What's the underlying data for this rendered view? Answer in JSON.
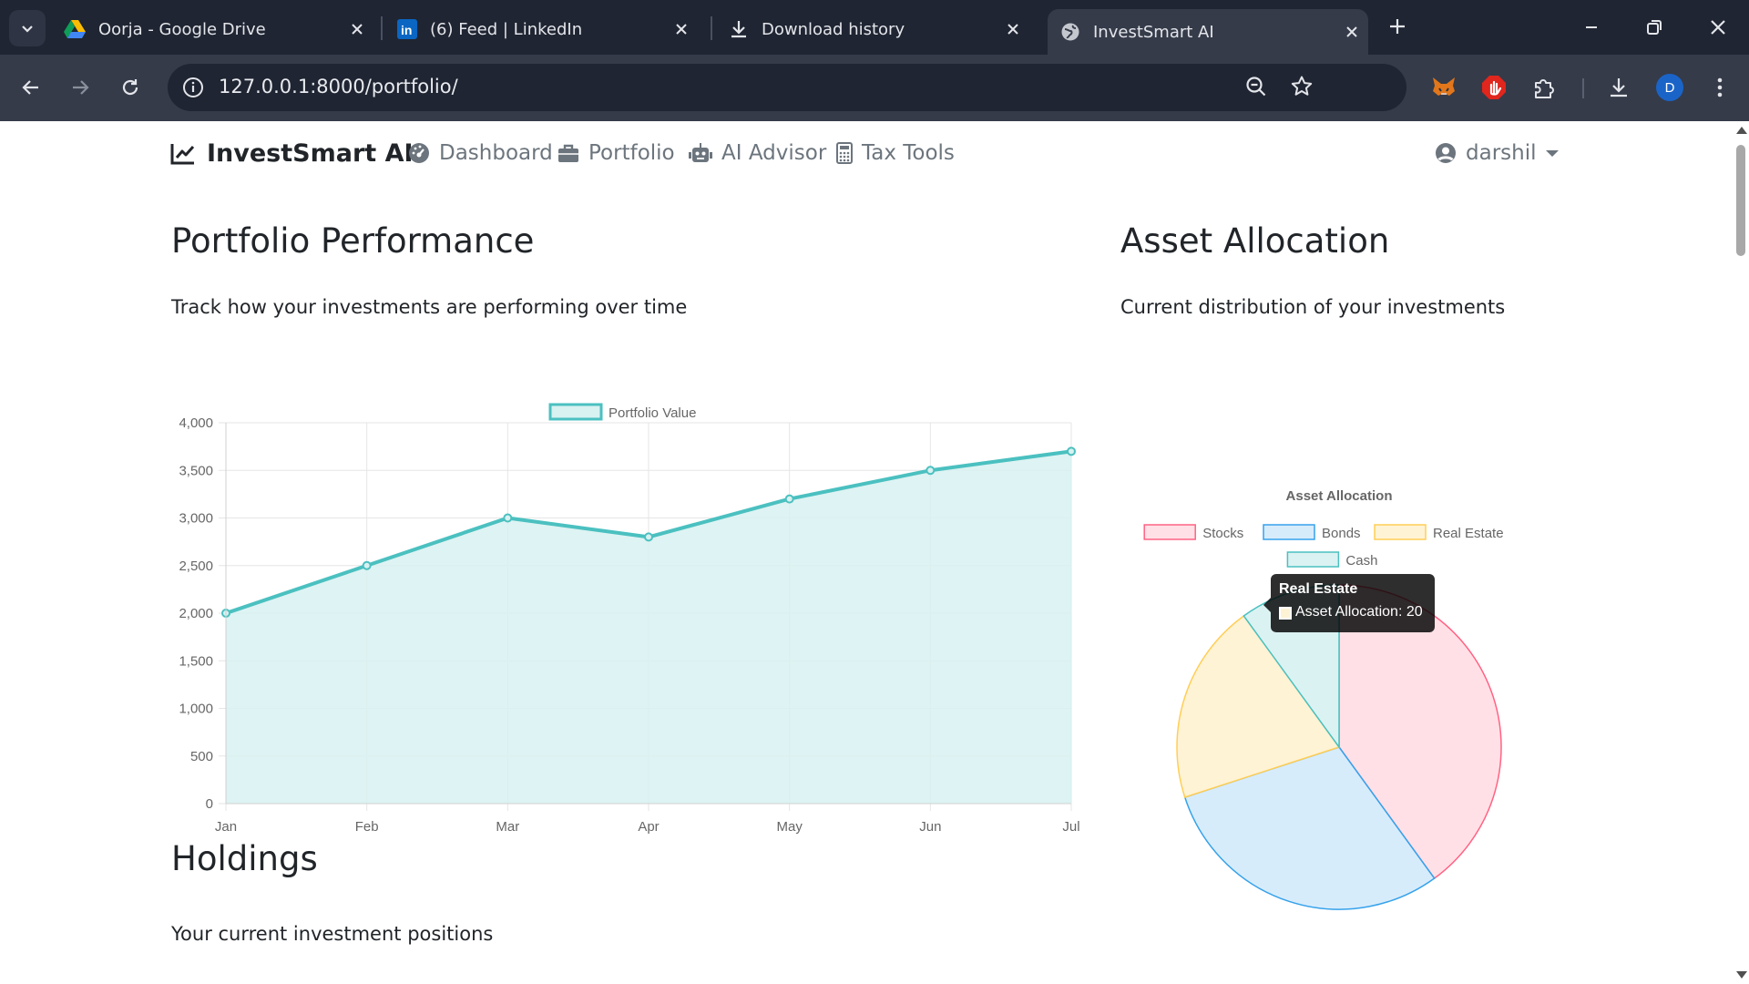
{
  "browser": {
    "tabs": [
      {
        "title": "Oorja - Google Drive",
        "icon": "google-drive-icon"
      },
      {
        "title": "(6) Feed | LinkedIn",
        "icon": "linkedin-icon"
      },
      {
        "title": "Download history",
        "icon": "download-icon"
      },
      {
        "title": "InvestSmart AI",
        "icon": "globe-icon",
        "active": true
      }
    ],
    "url": "127.0.0.1:8000/portfolio/",
    "profile_initial": "D"
  },
  "nav": {
    "brand": "InvestSmart AI",
    "links": [
      "Dashboard",
      "Portfolio",
      "AI Advisor",
      "Tax Tools"
    ],
    "user": "darshil"
  },
  "performance": {
    "heading": "Portfolio Performance",
    "subtitle": "Track how your investments are performing over time"
  },
  "allocation": {
    "heading": "Asset Allocation",
    "subtitle": "Current distribution of your investments"
  },
  "holdings": {
    "heading": "Holdings",
    "subtitle": "Your current investment positions"
  },
  "tooltip": {
    "title": "Real Estate",
    "body": "Asset Allocation: 20"
  },
  "chart_data": [
    {
      "type": "area",
      "legend": [
        "Portfolio Value"
      ],
      "categories": [
        "Jan",
        "Feb",
        "Mar",
        "Apr",
        "May",
        "Jun",
        "Jul"
      ],
      "series": [
        {
          "name": "Portfolio Value",
          "values": [
            2000,
            2500,
            3000,
            2800,
            3200,
            3500,
            3700
          ]
        }
      ],
      "ylim": [
        0,
        4000
      ],
      "yticks": [
        "0",
        "500",
        "1,000",
        "1,500",
        "2,000",
        "2,500",
        "3,000",
        "3,500",
        "4,000"
      ],
      "grid": true,
      "line_color": "#4bc0c0",
      "fill_color": "#d8f1f1"
    },
    {
      "type": "pie",
      "title": "Asset Allocation",
      "labels": [
        "Stocks",
        "Bonds",
        "Real Estate",
        "Cash"
      ],
      "values": [
        40,
        30,
        20,
        10
      ],
      "fill_colors": [
        "#ffe0e6",
        "#d7ecfb",
        "#fff3d6",
        "#dbf2f2"
      ],
      "border_colors": [
        "#ff6384",
        "#36a2eb",
        "#ffce56",
        "#4bc0c0"
      ],
      "legend_position": "top"
    }
  ]
}
